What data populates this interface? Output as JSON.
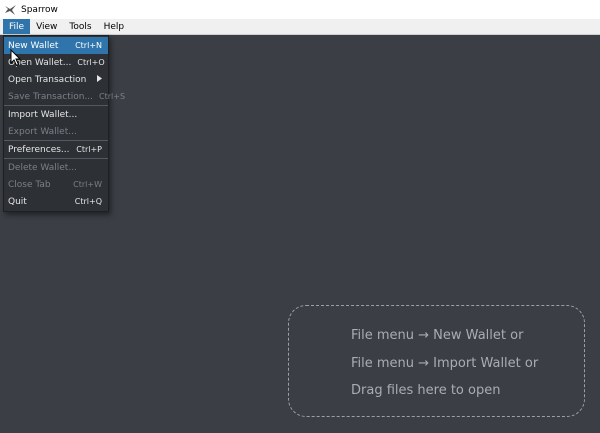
{
  "window": {
    "title": "Sparrow"
  },
  "menubar": {
    "items": [
      {
        "label": "File"
      },
      {
        "label": "View"
      },
      {
        "label": "Tools"
      },
      {
        "label": "Help"
      }
    ]
  },
  "file_menu": {
    "items": [
      {
        "label": "New Wallet",
        "accel": "Ctrl+N"
      },
      {
        "label": "Open Wallet...",
        "accel": "Ctrl+O"
      },
      {
        "label": "Open Transaction",
        "accel": ""
      },
      {
        "label": "Save Transaction...",
        "accel": "Ctrl+S"
      },
      {
        "label": "Import Wallet...",
        "accel": ""
      },
      {
        "label": "Export Wallet...",
        "accel": ""
      },
      {
        "label": "Preferences...",
        "accel": "Ctrl+P"
      },
      {
        "label": "Delete Wallet...",
        "accel": ""
      },
      {
        "label": "Close Tab",
        "accel": "Ctrl+W"
      },
      {
        "label": "Quit",
        "accel": "Ctrl+Q"
      }
    ]
  },
  "dropzone": {
    "lines": [
      "File menu → New Wallet or",
      "File menu → Import Wallet or",
      "Drag files here to open"
    ]
  },
  "colors": {
    "background": "#3b3f45",
    "menu_background": "#2d3035",
    "highlight": "#2f75ab",
    "disabled_text": "#7c8087"
  },
  "icons": {
    "app": "sparrow-logo-icon",
    "submenu": "chevron-right-icon",
    "pointer": "mouse-cursor-icon"
  }
}
